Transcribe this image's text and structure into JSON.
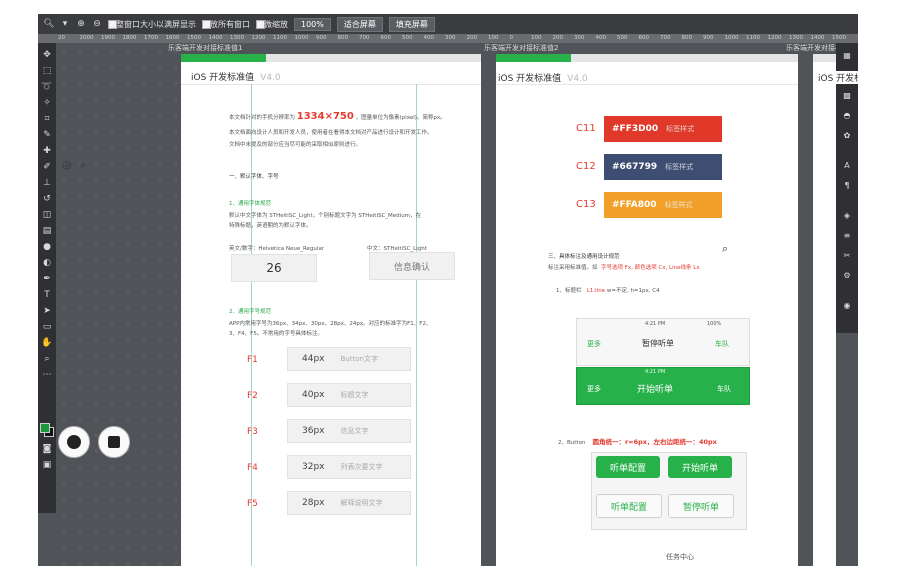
{
  "options_bar": {
    "resize_windows": "调整窗口大小以满屏显示",
    "zoom_all": "缩放所有窗口",
    "scrubby_zoom": "细微缩放",
    "zoom_level": "100%",
    "fit_screen": "适合屏幕",
    "fill_screen": "填充屏幕"
  },
  "ruler_ticks": [
    "20",
    "2000",
    "1900",
    "1800",
    "1700",
    "1600",
    "1500",
    "1400",
    "1300",
    "1200",
    "1100",
    "1000",
    "900",
    "800",
    "700",
    "600",
    "500",
    "400",
    "300",
    "200",
    "100",
    "0",
    "100",
    "200",
    "300",
    "400",
    "500",
    "600",
    "700",
    "800",
    "900",
    "1000",
    "1100",
    "1200",
    "1300",
    "1400",
    "1500"
  ],
  "doc_tabs": {
    "tab1": "乐客端开发对接标准值1",
    "tab2": "乐客端开发对接标准值2",
    "tab3": "乐客端开发对接标准值3"
  },
  "artboard1": {
    "title": "iOS 开发标准值",
    "version": "V4.0",
    "intro_pre": "本文档针对的手机分辨率为",
    "intro_res": "1334×750",
    "intro_post": "，图量单位为像素(pixel)。简称px。",
    "intro2": "本文档面向设计人员和开发人员，使用者在看得本文档对产品进行设计和开发工作。",
    "intro3": "文档中未提及的部分应当尽可能的采取相似原则进行。",
    "section1": "一、默认字体、字号",
    "sub1": "1、通用字体规范",
    "font_desc": "默认中文字体为 STHeitiSC_Light，个别标题文字为 STHeitiSC_Medium，在",
    "font_desc2": "特殊标题，英语期的为默认字体。",
    "en_font_label": "英文/数字：Helvetica Neue_Regular",
    "cn_font_label": "中文：STHeitiSC_Light",
    "sample_number": "26",
    "sample_text": "信息确认",
    "sub2": "2、通用字号规范",
    "size_desc": "APP内常用字号为36px、34px、30px、28px、24px。对应的标准字为F1、F2、",
    "size_desc2": "3、F4、F5。不常用的字号具体标注。",
    "fonts": [
      {
        "id": "F1",
        "px": "44px",
        "desc": "Button文字"
      },
      {
        "id": "F2",
        "px": "40px",
        "desc": "标题文字"
      },
      {
        "id": "F3",
        "px": "36px",
        "desc": "信息文字"
      },
      {
        "id": "F4",
        "px": "32px",
        "desc": "列表次要文字"
      },
      {
        "id": "F5",
        "px": "28px",
        "desc": "解释说明文字"
      }
    ]
  },
  "artboard2": {
    "title": "iOS 开发标准值",
    "version": "V4.0",
    "colors": [
      {
        "id": "C11",
        "hex": "#FF3D00",
        "label": "标签样式",
        "color": "#e0392a"
      },
      {
        "id": "C12",
        "hex": "#667799",
        "label": "标签样式",
        "color": "#3e4d72"
      },
      {
        "id": "C13",
        "hex": "#FFA800",
        "label": "标签样式",
        "color": "#f2a02a"
      }
    ],
    "section3": "三、具体标注及通用设计规范",
    "section3_desc_pre": "标注采用标准值。如",
    "section3_f": "字号选项 Fx",
    "section3_c": "颜色选项 Cx",
    "section3_l": "Line线条 Lx",
    "sub_nav": "1、标题栏",
    "nav_spec_l": "L1:line",
    "nav_spec_rest": "w=不定, h=1px, C4",
    "phone_time": "4:21 PM",
    "phone_battery": "100%",
    "nav_back": "更多",
    "nav_title_pause": "暂停听单",
    "nav_right": "车队",
    "nav_title_start": "开始听单",
    "sub_button": "2、Button",
    "button_spec": "圆角统一：r=6px，左右边距统一：40px",
    "btn_config": "听单配置",
    "btn_start": "开始听单",
    "btn_config2": "听单配置",
    "btn_pause": "暂停听单",
    "bottom_label": "任务中心"
  },
  "artboard3": {
    "title": "iOS 开发标"
  }
}
